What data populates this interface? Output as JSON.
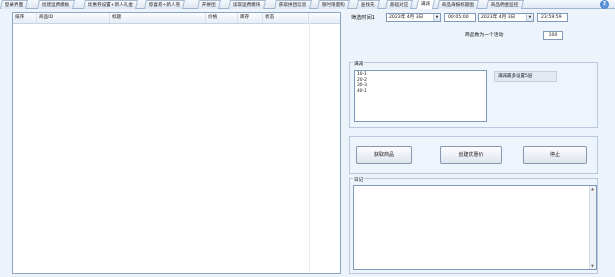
{
  "tabs": [
    {
      "label": "登录界面",
      "active": false
    },
    {
      "label": "创建运费模板",
      "active": false
    },
    {
      "label": "优惠券设置+新人礼金",
      "active": false
    },
    {
      "label": "惊喜卷+新人卷",
      "active": false
    },
    {
      "label": "开拼团",
      "active": false
    },
    {
      "label": "读取运费模块",
      "active": false
    },
    {
      "label": "获取拼团信息",
      "active": false
    },
    {
      "label": "限时限量购",
      "active": false
    },
    {
      "label": "查找先",
      "active": false
    },
    {
      "label": "基础对应",
      "active": false
    },
    {
      "label": "满减",
      "active": true
    },
    {
      "label": "商品海报标题图",
      "active": false
    },
    {
      "label": "商品佣金监控",
      "active": false
    }
  ],
  "table": {
    "columns": [
      "排序",
      "商品ID",
      "标题",
      "价格",
      "库存",
      "状态"
    ]
  },
  "filter": {
    "label": "筛选时间1",
    "start_date": "2023年 4月 3日",
    "start_time": "00:05:00",
    "end_date": "2023年 4月 3日",
    "end_time": "23:59:59"
  },
  "products_per_activity": {
    "label": "商品数为一个活动",
    "value": "100"
  },
  "discount_group": {
    "title": "满减",
    "rules": [
      "10-1",
      "20-2",
      "30-3",
      "40-1"
    ],
    "note": "满减最多设置5层"
  },
  "buttons": {
    "get_products": "获取商品",
    "create_coupon": "创建优惠价",
    "stop": "停止"
  },
  "log": {
    "title": "日记"
  },
  "help_icon": "?"
}
